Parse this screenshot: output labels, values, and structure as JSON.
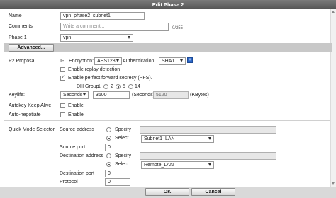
{
  "dialog": {
    "title": "Edit Phase 2"
  },
  "fields": {
    "name_label": "Name",
    "name_value": "vpn_phase2_subnet1",
    "comments_label": "Comments",
    "comments_placeholder": "Write a comment...",
    "comments_counter": "0/255",
    "phase1_label": "Phase 1",
    "phase1_value": "vpn",
    "advanced_button": "Advanced..."
  },
  "proposal": {
    "label": "P2 Proposal",
    "index": "1-",
    "encryption_label": "Encryption:",
    "encryption_value": "AES128",
    "authentication_label": "Authentication:",
    "authentication_value": "SHA1",
    "replay_label": "Enable replay detection",
    "replay_checked": false,
    "pfs_label": "Enable perfect forward secrecy (PFS).",
    "pfs_checked": true,
    "dh_group_label": "DH Group",
    "dh_options": [
      "1",
      "2",
      "5",
      "14"
    ],
    "dh_selected": "5"
  },
  "keylife": {
    "label": "Keylife:",
    "unit_value": "Seconds",
    "seconds_value": "3600",
    "seconds_label": "(Seconds)",
    "kbytes_value": "5120",
    "kbytes_label": "(KBytes)"
  },
  "autokey": {
    "label": "Autokey Keep Alive",
    "option": "Enable",
    "checked": false
  },
  "autonegotiate": {
    "label": "Auto-negotiate",
    "option": "Enable",
    "checked": false
  },
  "quick_mode": {
    "label": "Quick Mode Selector",
    "source_address_label": "Source address",
    "source_specify": "Specify",
    "source_select": "Select",
    "source_select_value": "Subnet1_LAN",
    "source_port_label": "Source port",
    "source_port_value": "0",
    "destination_address_label": "Destination address",
    "destination_specify": "Specify",
    "destination_select": "Select",
    "destination_select_value": "Remote_LAN",
    "destination_port_label": "Destination port",
    "destination_port_value": "0",
    "protocol_label": "Protocol",
    "protocol_value": "0"
  },
  "footer": {
    "ok": "OK",
    "cancel": "Cancel"
  },
  "colors": {
    "title_bar": "#5f5f5f",
    "advanced_bar": "#c8c8c8",
    "footer": "#d9d9d9",
    "help_icon": "#2b67c8"
  },
  "icons": {
    "help": "help-icon",
    "dropdown": "chevron-down-icon"
  }
}
